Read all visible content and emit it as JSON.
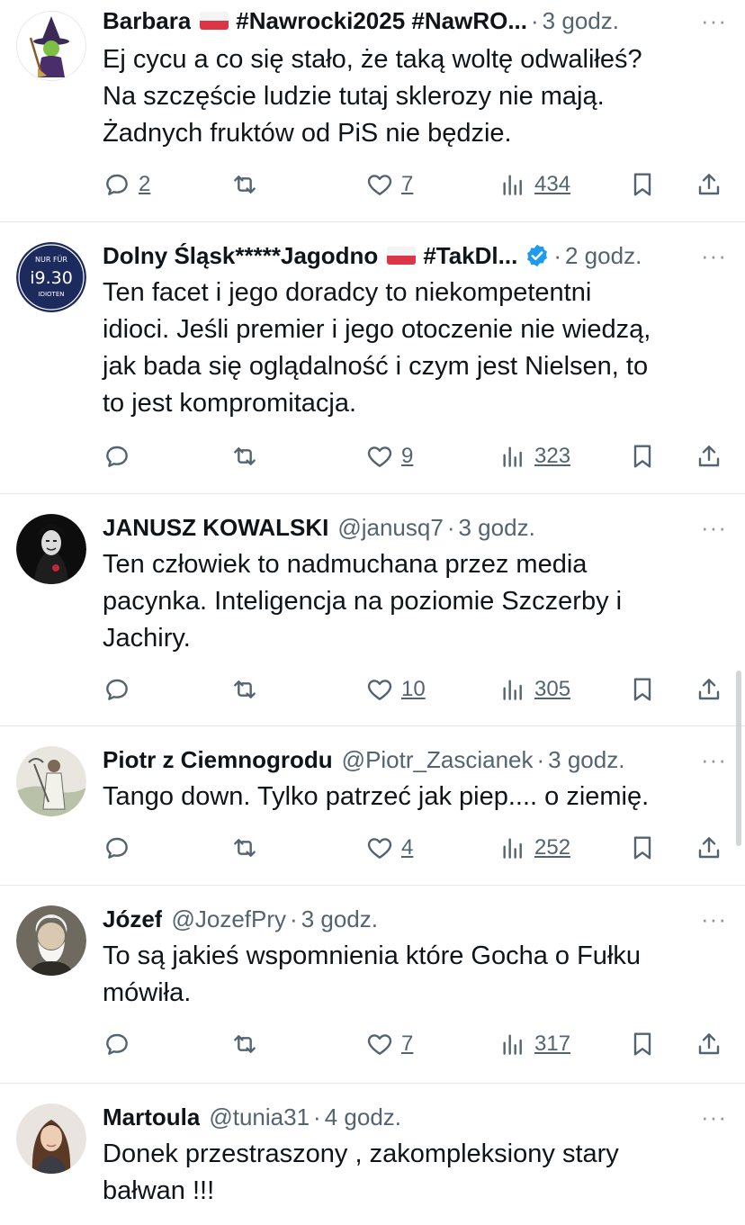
{
  "more_label": "···",
  "tweets": [
    {
      "name": "Barbara",
      "flag": true,
      "handle": "",
      "extra": "#Nawrocki2025 #NawRO...",
      "time": "3 godz.",
      "text_lines": [
        "Ej cycu a co się stało, że taką woltę odwaliłeś?",
        "Na szczęście ludzie tutaj sklerozy nie mają.",
        "Żadnych fruktów od PiS nie będzie."
      ],
      "replies": "2",
      "likes": "7",
      "views": "434"
    },
    {
      "name": "Dolny Śląsk*****Jagodno",
      "flag": true,
      "handle": "",
      "extra": "#TakDl...",
      "verified": true,
      "time": "2 godz.",
      "text_lines": [
        "Ten facet i jego doradcy to niekompetentni",
        "idioci. Jeśli premier i jego otoczenie nie wiedzą,",
        "jak bada się oglądalność i czym jest Nielsen, to",
        "to jest kompromitacja."
      ],
      "replies": "",
      "likes": "9",
      "views": "323",
      "avatar_text": {
        "top": "NUR FÜR",
        "mid": "i9.30",
        "bottom": "IDIOTEN"
      }
    },
    {
      "name": "JANUSZ KOWALSKI",
      "handle": "@janusq7",
      "time": "3 godz.",
      "text_lines": [
        "Ten człowiek to nadmuchana przez media",
        "pacynka. Inteligencja na poziomie Szczerby i",
        "Jachiry."
      ],
      "replies": "",
      "likes": "10",
      "views": "305"
    },
    {
      "name": "Piotr z Ciemnogrodu",
      "handle": "@Piotr_Zascianek",
      "time": "3 godz.",
      "text_lines": [
        "Tango down. Tylko patrzeć jak piep.... o ziemię."
      ],
      "replies": "",
      "likes": "4",
      "views": "252"
    },
    {
      "name": "Józef",
      "handle": "@JozefPry",
      "time": "3 godz.",
      "text_lines": [
        "To są jakieś wspomnienia które Gocha o Fułku",
        "mówiła."
      ],
      "replies": "",
      "likes": "7",
      "views": "317"
    },
    {
      "name": "Martoula",
      "handle": "@tunia31",
      "time": "4 godz.",
      "text_lines": [
        "Donek przestraszony , zakompleksiony stary",
        "bałwan !!!"
      ],
      "replies": null,
      "likes": null,
      "views": null
    }
  ],
  "colors": {
    "text": "#0f1419",
    "secondary": "#536471",
    "verified": "#1d9bf0",
    "divider": "#e6e9ec"
  }
}
